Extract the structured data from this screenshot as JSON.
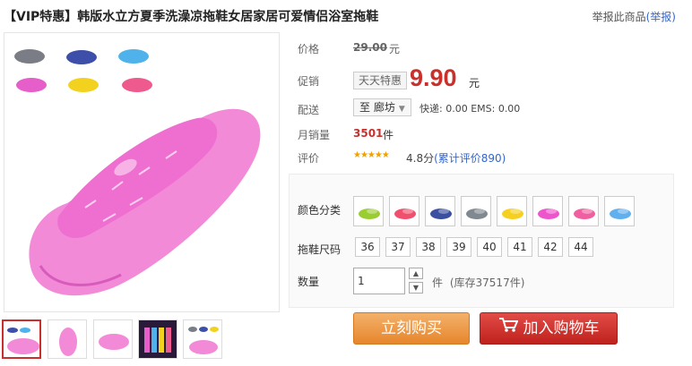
{
  "header": {
    "title": "【VIP特惠】韩版水立方夏季洗澡凉拖鞋女居家居可爱情侣浴室拖鞋",
    "report_text": "举报此商品",
    "report_link": "(举报)"
  },
  "price": {
    "label": "价格",
    "original": "29.00",
    "currency": "元"
  },
  "promo": {
    "label": "促销",
    "tag": "天天特惠",
    "price": "9.90",
    "currency": "元"
  },
  "shipping": {
    "label": "配送",
    "destination": "至 廊坊",
    "fees": "快递: 0.00 EMS: 0.00"
  },
  "sales": {
    "label": "月销量",
    "count": "3501",
    "unit": "件"
  },
  "rating": {
    "label": "评价",
    "stars": "★★★★★",
    "score": "4.8分",
    "reviews": "(累计评价890)"
  },
  "options": {
    "color_label": "颜色分类",
    "size_label": "拖鞋尺码",
    "sizes": [
      "36",
      "37",
      "38",
      "39",
      "40",
      "41",
      "42",
      "44"
    ],
    "qty_label": "数量",
    "qty_value": "1",
    "qty_unit": "件",
    "stock": "(库存37517件)",
    "color_swatches": [
      "#9acd32",
      "#f0506e",
      "#3a4fa0",
      "#808890",
      "#f5d020",
      "#ee55cc",
      "#f060a0",
      "#60b0f0"
    ]
  },
  "actions": {
    "buy_now": "立刻购买",
    "add_cart": "加入购物车"
  },
  "colors": {
    "accent_red": "#c9302c",
    "buy_orange": "#e6862c",
    "link_blue": "#3366cc"
  }
}
